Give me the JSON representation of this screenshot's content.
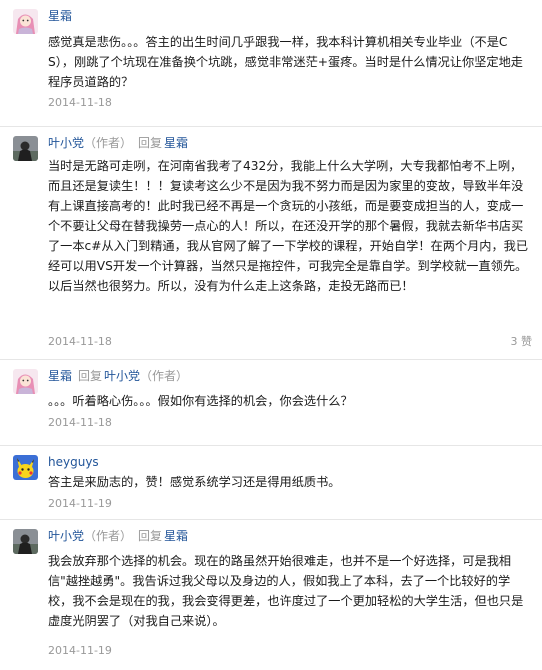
{
  "comments": [
    {
      "user": "星霜",
      "avatar": "pink-girl-avatar",
      "text": "感觉真是悲伤。。。答主的出生时间几乎跟我一样，我本科计算机相关专业毕业（不是CS），刚跳了个坑现在准备换个坑跳，感觉非常迷茫+蛋疼。当时是什么情况让你坚定地走程序员道路的？",
      "date": "2014-11-18"
    },
    {
      "user": "叶小党",
      "role": "（作者）",
      "reply_label": "回复",
      "reply_to": "星霜",
      "avatar": "dark-figure-avatar",
      "text": "当时是无路可走咧，在河南省我考了432分，我能上什么大学咧，大专我都怕考不上咧，而且还是复读生！！！复读考这么少不是因为我不努力而是因为家里的变故，导致半年没有上课直接高考的！此时我已经不再是一个贪玩的小孩纸，而是要变成担当的人，变成一个不要让父母在替我操劳一点心的人！所以，在还没开学的那个暑假，我就去新华书店买了一本c#从入门到精通，我从官网了解了一下学校的课程，开始自学！在两个月内，我已经可以用VS开发一个计算器，当然只是拖控件，可我完全是靠自学。到学校就一直领先。以后当然也很努力。所以，没有为什么走上这条路，走投无路而已！",
      "date": "2014-11-18",
      "likes": "3 赞"
    },
    {
      "user": "星霜",
      "reply_label": "回复",
      "reply_to": "叶小党",
      "reply_to_role": "（作者）",
      "avatar": "pink-girl-avatar",
      "text": "。。。听着略心伤。。。假如你有选择的机会，你会选什么？",
      "date": "2014-11-18"
    },
    {
      "user": "heyguys",
      "avatar": "pikachu-avatar",
      "text": "答主是来励志的，赞！感觉系统学习还是得用纸质书。",
      "date": "2014-11-19"
    },
    {
      "user": "叶小党",
      "role": "（作者）",
      "reply_label": "回复",
      "reply_to": "星霜",
      "avatar": "dark-figure-avatar",
      "text": "我会放弃那个选择的机会。现在的路虽然开始很难走，也并不是一个好选择，可是我相信\"越挫越勇\"。我告诉过我父母以及身边的人，假如我上了本科，去了一个比较好的学校，我不会是现在的我，我会变得更差，也许度过了一个更加轻松的大学生活，但也只是虚度光阴罢了（对我自己来说）。",
      "date": "2014-11-19"
    }
  ]
}
